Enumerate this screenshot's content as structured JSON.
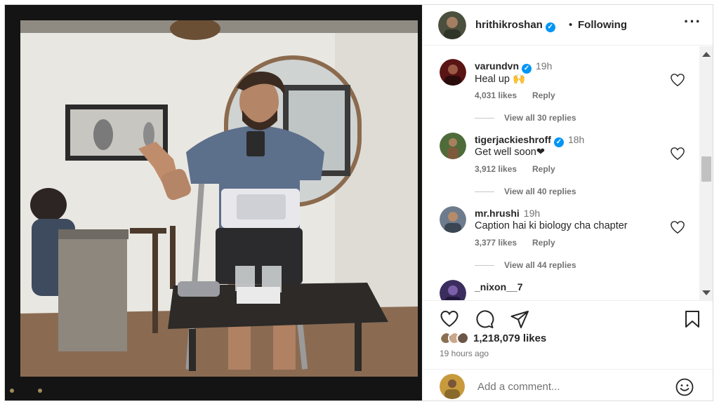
{
  "header": {
    "username": "hrithikroshan",
    "separator": "•",
    "follow_label": "Following",
    "more_icon": "more-options-icon"
  },
  "comments": [
    {
      "username": "varundvn",
      "verified": true,
      "time": "19h",
      "text": "Heal up 🙌",
      "likes": "4,031 likes",
      "reply_label": "Reply",
      "view_replies": "View all 30 replies"
    },
    {
      "username": "tigerjackieshroff",
      "verified": true,
      "time": "18h",
      "text": "Get well soon❤",
      "likes": "3,912 likes",
      "reply_label": "Reply",
      "view_replies": "View all 40 replies"
    },
    {
      "username": "mr.hrushi",
      "verified": false,
      "time": "19h",
      "text": "Caption hai ki biology cha chapter",
      "likes": "3,377 likes",
      "reply_label": "Reply",
      "view_replies": "View all 44 replies"
    },
    {
      "username": "_nixon__7",
      "verified": false,
      "time": "",
      "text": "",
      "likes": "",
      "reply_label": "",
      "view_replies": ""
    }
  ],
  "actions": {
    "like_icon": "heart-icon",
    "comment_icon": "comment-icon",
    "share_icon": "send-icon",
    "save_icon": "bookmark-icon"
  },
  "likes_count": "1,218,079 likes",
  "posted_time": "19 hours ago",
  "add_comment": {
    "placeholder": "Add a comment...",
    "emoji_icon": "emoji-icon"
  },
  "colors": {
    "verified_blue": "#0095f6",
    "text_primary": "#262626",
    "text_secondary": "#737373"
  }
}
